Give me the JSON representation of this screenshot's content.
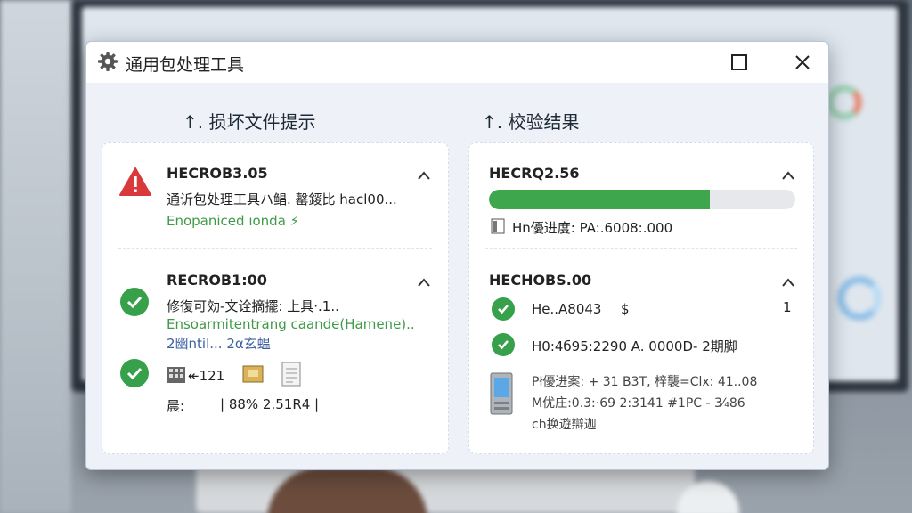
{
  "dialog": {
    "title": "通用包处理工具"
  },
  "left_section": {
    "heading": "↑. 损坏文件提示",
    "entries": [
      {
        "title": "HECROB3.05",
        "line1": "通䜣包处理工具ハ鲳. 罄錽比 hacl00...",
        "line2": "Enopaniced ıonda ⚡"
      },
      {
        "title": "RECROB1:00",
        "line1": "修復可効-文诠摘擺: 上具·.1..",
        "line2": "Ensoarmitentrang caande(Hamene)..",
        "line3": "2幽ntil... 2α玄蝹",
        "files_label": "↞121",
        "size_label": "| 88% 2.51R4 |",
        "row_label": "晨:"
      }
    ]
  },
  "right_section": {
    "heading": "↑. 校验结果",
    "entries": [
      {
        "title": "HECRQ2.56",
        "progress": 0.72,
        "progress_label": "Hn優进度:  PA:.6008:.000"
      },
      {
        "title": "HECHOBS.00",
        "items": [
          {
            "label": "He..A8043",
            "extra": "$",
            "count": "1"
          },
          {
            "label": "H0:4б95:2290 A. 0000D-  2期脚"
          }
        ],
        "details": [
          "Pł優进案: + 31 B3T,  梓襲=Clx:  41..08",
          "M优庄:0.3:·69 2:3141   #1PC - 3⁄₄86",
          "ch换遊辯迦"
        ]
      }
    ]
  },
  "colors": {
    "accent_green": "#3ea64d",
    "error_red": "#d8393a",
    "titlebar_bg": "#ffffff",
    "dialog_bg": "#eef2f8"
  }
}
